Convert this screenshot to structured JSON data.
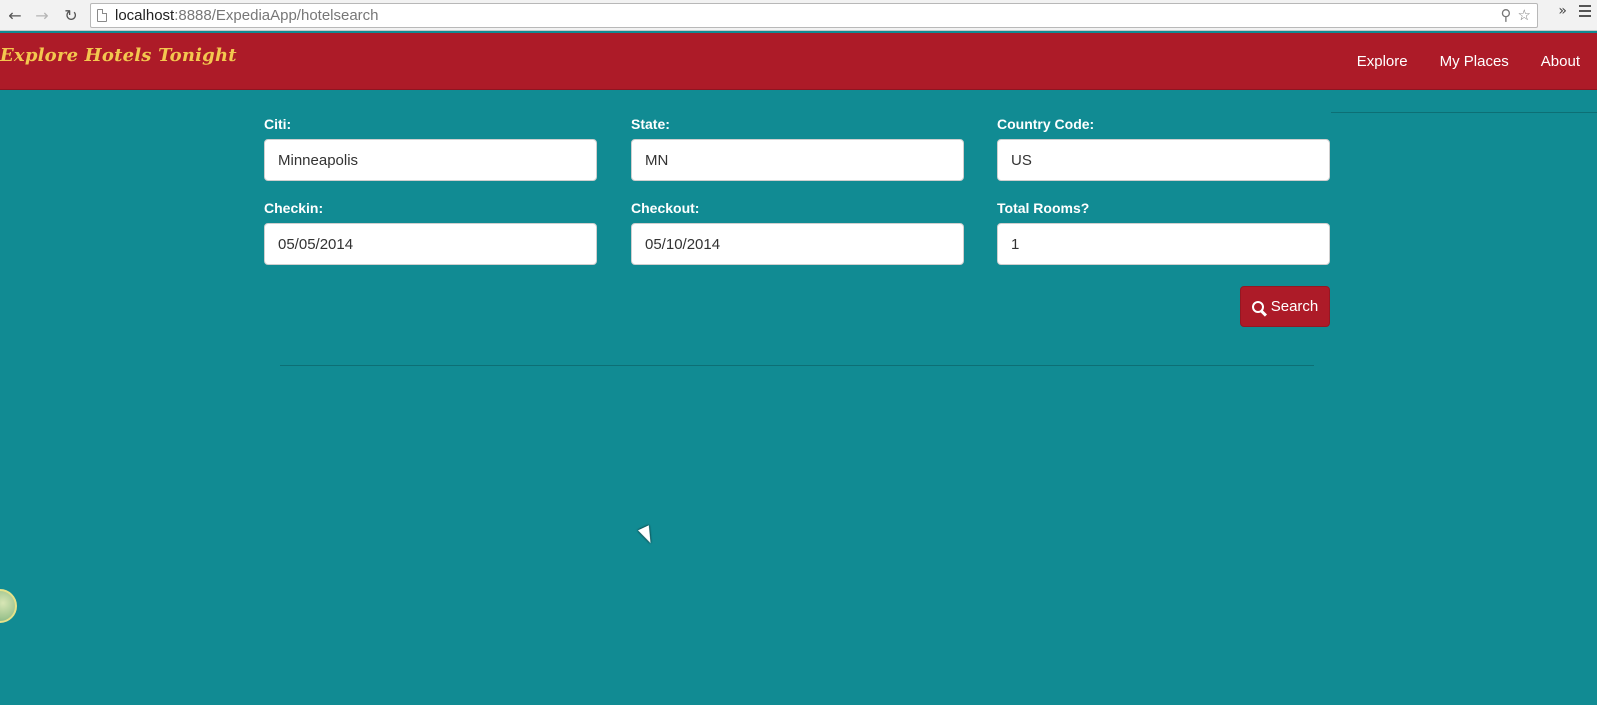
{
  "browser": {
    "url_host": "localhost",
    "url_path": ":8888/ExpediaApp/hotelsearch"
  },
  "navbar": {
    "brand": "Explore Hotels Tonight",
    "links": [
      "Explore",
      "My Places",
      "About"
    ]
  },
  "form": {
    "city": {
      "label": "Citi:",
      "value": "Minneapolis"
    },
    "state": {
      "label": "State:",
      "value": "MN"
    },
    "country": {
      "label": "Country Code:",
      "value": "US"
    },
    "checkin": {
      "label": "Checkin:",
      "value": "05/05/2014"
    },
    "checkout": {
      "label": "Checkout:",
      "value": "05/10/2014"
    },
    "rooms": {
      "label": "Total Rooms?",
      "value": "1"
    },
    "search_label": "Search"
  },
  "colors": {
    "navbar": "#ad1b28",
    "brand": "#f3c74f",
    "background": "#118b93"
  }
}
